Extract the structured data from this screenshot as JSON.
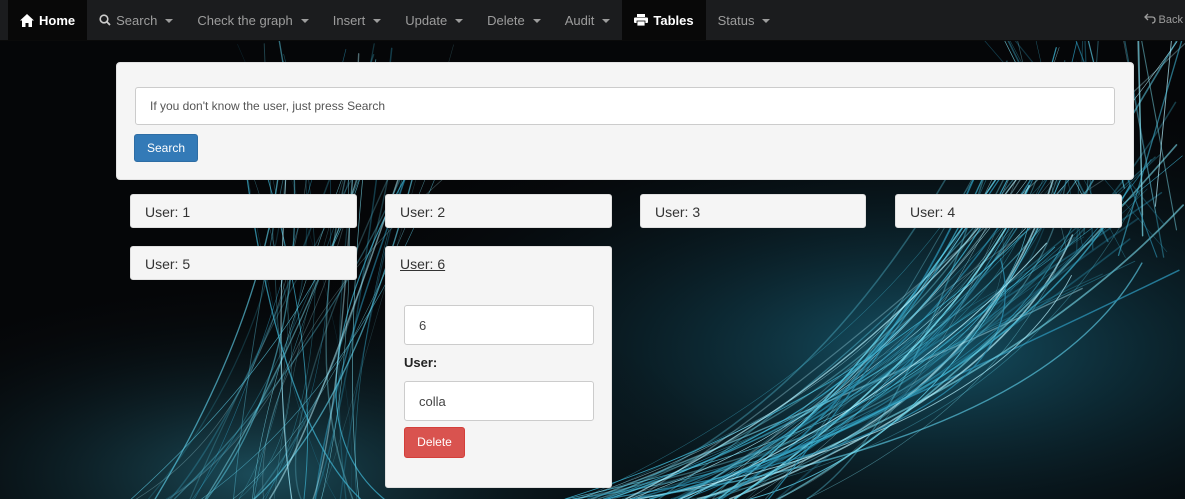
{
  "navbar": {
    "items": [
      {
        "label": "Home",
        "icon": "home-icon",
        "dropdown": false,
        "active": true
      },
      {
        "label": "Search",
        "icon": "search-icon",
        "dropdown": true,
        "active": false
      },
      {
        "label": "Check the graph",
        "icon": "",
        "dropdown": true,
        "active": false
      },
      {
        "label": "Insert",
        "icon": "",
        "dropdown": true,
        "active": false
      },
      {
        "label": "Update",
        "icon": "",
        "dropdown": true,
        "active": false
      },
      {
        "label": "Delete",
        "icon": "",
        "dropdown": true,
        "active": false
      },
      {
        "label": "Audit",
        "icon": "",
        "dropdown": true,
        "active": false
      },
      {
        "label": "Tables",
        "icon": "print-icon",
        "dropdown": false,
        "active": true
      },
      {
        "label": "Status",
        "icon": "",
        "dropdown": true,
        "active": false
      }
    ],
    "back_label": "Back"
  },
  "search": {
    "placeholder": "If you don't know the user, just press Search",
    "button_label": "Search"
  },
  "users": [
    {
      "label": "User: 1"
    },
    {
      "label": "User: 2"
    },
    {
      "label": "User: 3"
    },
    {
      "label": "User: 4"
    },
    {
      "label": "User: 5"
    },
    {
      "label": "User: 6"
    }
  ],
  "expanded_user": {
    "id_value": "6",
    "user_field_label": "User:",
    "user_value": "colla",
    "delete_label": "Delete"
  },
  "colors": {
    "navbar_bg": "#1b1c1e",
    "primary": "#337ab7",
    "danger": "#d9534f",
    "panel_bg": "#f5f5f5"
  }
}
